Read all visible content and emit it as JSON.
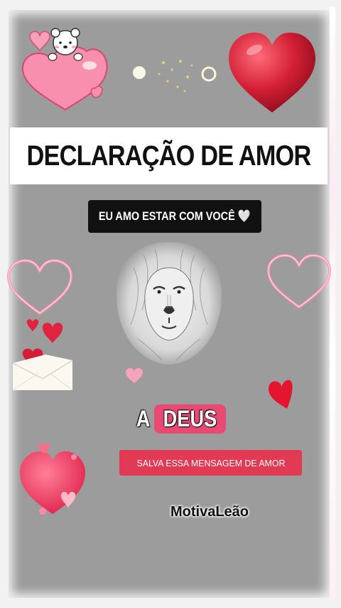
{
  "title": "DECLARAÇÃO DE AMOR",
  "subtitle": "EU AMO ESTAR COM VOCÊ 🤍",
  "deus": {
    "prefix": "A",
    "word": "DEUS"
  },
  "cta": "SALVA ESSA MENSAGEM DE AMOR",
  "brand": "MotivaLeão",
  "colors": {
    "panel": "#9c9c9c",
    "heart_red": "#e0233e",
    "heart_pink": "#f4879d",
    "cta": "#e23a55",
    "deus_box": "#e84a74"
  },
  "icons": [
    "teddy-bear-heart-icon",
    "red-heart-icon",
    "sparkle-icon",
    "outline-heart-icon",
    "lion-image",
    "envelope-hearts-icon",
    "small-heart-icon",
    "pink-heart-cluster-icon"
  ]
}
